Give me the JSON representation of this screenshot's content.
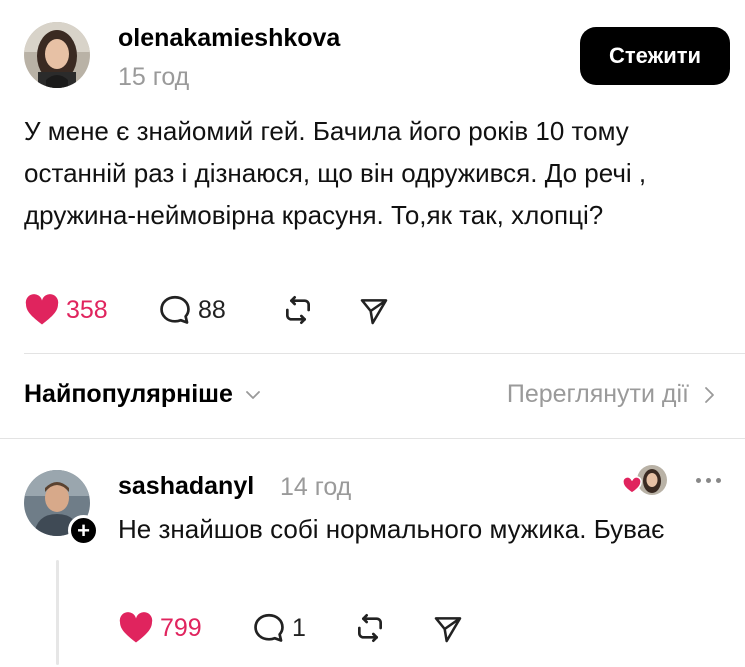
{
  "post": {
    "username": "olenakamieshkova",
    "time": "15 год",
    "follow_label": "Стежити",
    "text": "У мене є знайомий гей. Бачила його років 10 тому останній раз і дізнаюся, що він одружився.  До речі , дружина-неймовірна красуня. То,як так, хлопці?",
    "likes": "358",
    "replies": "88"
  },
  "replies_header": {
    "sort_label": "Найпопулярніше",
    "activity_label": "Переглянути дії"
  },
  "comment": {
    "username": "sashadanyl",
    "time": "14 год",
    "text": "Не знайшов собі нормального мужика. Буває",
    "likes": "799",
    "replies": "1"
  },
  "colors": {
    "like": "#e0245e",
    "follow_bg": "#000000",
    "muted": "#9a9a9a"
  }
}
